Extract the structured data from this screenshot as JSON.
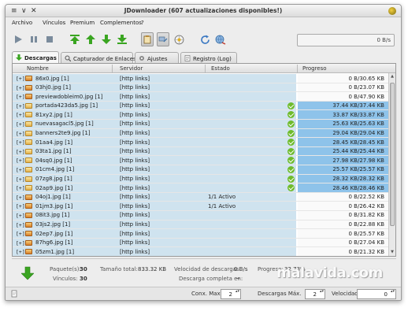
{
  "window": {
    "title": "JDownloader (607 actualizaciones disponibles!)"
  },
  "menu": [
    "Archivo",
    "Vínculos",
    "Premium",
    "Complementos",
    "?"
  ],
  "toolbar": {
    "speed": "0 B/s"
  },
  "tabs": [
    "Descargas",
    "Capturador de Enlaces",
    "Ajustes",
    "Registro (Log)"
  ],
  "columns": {
    "name": "Nombre",
    "host": "Servidor",
    "status": "Estado",
    "progress": "Progreso"
  },
  "rows": [
    {
      "expand": "[+]",
      "name": "86x0.jpg [1]",
      "host": "[http links]",
      "status": "",
      "done": false,
      "progress": 0,
      "progress_text": "0 B/30.65 KB"
    },
    {
      "expand": "[+]",
      "name": "03hj0.jpg [1]",
      "host": "[http links]",
      "status": "",
      "done": false,
      "progress": 0,
      "progress_text": "0 B/23.07 KB"
    },
    {
      "expand": "[+]",
      "name": "previewdobleim0.jpg [1]",
      "host": "[http links]",
      "status": "",
      "done": false,
      "progress": 0,
      "progress_text": "0 B/47.90 KB"
    },
    {
      "expand": "[+]",
      "name": "portada423da5.jpg [1]",
      "host": "[http links]",
      "status": "",
      "done": true,
      "progress": 1,
      "progress_text": "37.44 KB/37.44 KB"
    },
    {
      "expand": "[+]",
      "name": "81xy2.jpg [1]",
      "host": "[http links]",
      "status": "",
      "done": true,
      "progress": 1,
      "progress_text": "33.87 KB/33.87 KB"
    },
    {
      "expand": "[+]",
      "name": "nuevasagacl5.jpg [1]",
      "host": "[http links]",
      "status": "",
      "done": true,
      "progress": 1,
      "progress_text": "25.63 KB/25.63 KB"
    },
    {
      "expand": "[+]",
      "name": "banners2te9.jpg [1]",
      "host": "[http links]",
      "status": "",
      "done": true,
      "progress": 1,
      "progress_text": "29.04 KB/29.04 KB"
    },
    {
      "expand": "[+]",
      "name": "01aa4.jpg [1]",
      "host": "[http links]",
      "status": "",
      "done": true,
      "progress": 1,
      "progress_text": "28.45 KB/28.45 KB"
    },
    {
      "expand": "[+]",
      "name": "03ta1.jpg [1]",
      "host": "[http links]",
      "status": "",
      "done": true,
      "progress": 1,
      "progress_text": "25.44 KB/25.44 KB"
    },
    {
      "expand": "[+]",
      "name": "04sq0.jpg [1]",
      "host": "[http links]",
      "status": "",
      "done": true,
      "progress": 1,
      "progress_text": "27.98 KB/27.98 KB"
    },
    {
      "expand": "[+]",
      "name": "01cm4.jpg [1]",
      "host": "[http links]",
      "status": "",
      "done": true,
      "progress": 1,
      "progress_text": "25.57 KB/25.57 KB"
    },
    {
      "expand": "[+]",
      "name": "07zg8.jpg [1]",
      "host": "[http links]",
      "status": "",
      "done": true,
      "progress": 1,
      "progress_text": "28.32 KB/28.32 KB"
    },
    {
      "expand": "[+]",
      "name": "02ap9.jpg [1]",
      "host": "[http links]",
      "status": "",
      "done": true,
      "progress": 1,
      "progress_text": "28.46 KB/28.46 KB"
    },
    {
      "expand": "[+]",
      "name": "04oj1.jpg [1]",
      "host": "[http links]",
      "status": "1/1 Activo",
      "done": false,
      "progress": 0,
      "progress_text": "0 B/22.52 KB"
    },
    {
      "expand": "[+]",
      "name": "01jm3.jpg [1]",
      "host": "[http links]",
      "status": "1/1 Activo",
      "done": false,
      "progress": 0,
      "progress_text": "0 B/26.42 KB"
    },
    {
      "expand": "[+]",
      "name": "08it3.jpg [1]",
      "host": "[http links]",
      "status": "",
      "done": false,
      "progress": 0,
      "progress_text": "0 B/31.82 KB"
    },
    {
      "expand": "[+]",
      "name": "03js2.jpg [1]",
      "host": "[http links]",
      "status": "",
      "done": false,
      "progress": 0,
      "progress_text": "0 B/22.88 KB"
    },
    {
      "expand": "[+]",
      "name": "02ep7.jpg [1]",
      "host": "[http links]",
      "status": "",
      "done": false,
      "progress": 0,
      "progress_text": "0 B/25.57 KB"
    },
    {
      "expand": "[+]",
      "name": "87hg6.jpg [1]",
      "host": "[http links]",
      "status": "",
      "done": false,
      "progress": 0,
      "progress_text": "0 B/27.04 KB"
    },
    {
      "expand": "[+]",
      "name": "05zm1.jpg [1]",
      "host": "[http links]",
      "status": "",
      "done": false,
      "progress": 0,
      "progress_text": "0 B/21.32 KB"
    }
  ],
  "summary": {
    "packages_label": "Paquete(s):",
    "packages": "30",
    "links_label": "Vínculos:",
    "links": "30",
    "total_size_label": "Tamaño total:",
    "total_size": "833.32 KB",
    "speed_label": "Velocidad de descargas:",
    "speed": "0 B/s",
    "progress_label": "Progreso:",
    "progress": "32.73%",
    "eta_label": "Descarga completa en:",
    "eta": "~"
  },
  "statusbar": {
    "max_conn_label": "Conx. Max.",
    "max_conn": "2",
    "max_downloads_label": "Descargas Máx.",
    "max_downloads": "2",
    "speed_label": "Velocidad",
    "speed": "0"
  },
  "watermark": "malavida.com",
  "colors": {
    "row_bg": "#cfe3ef",
    "progress_fill": "#8ec3ea",
    "check": "#6fbb2c",
    "arrow_green": "#3aa521"
  }
}
